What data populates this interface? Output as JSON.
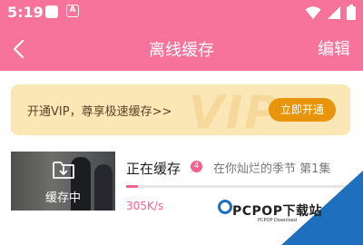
{
  "status_bar": {
    "time": "5:19",
    "icons": [
      "app-square-icon",
      "a-badge-icon",
      "wifi-icon",
      "signal-icon",
      "battery-icon"
    ]
  },
  "header": {
    "back_icon": "chevron-left-icon",
    "title": "离线缓存",
    "edit_label": "编辑"
  },
  "vip_banner": {
    "text": "开通VIP，尊享极速缓存>>",
    "button_label": "立即开通",
    "watermark": "VIP"
  },
  "download_item": {
    "thumbnail_caption": "缓存中",
    "status": "正在缓存",
    "count": "4",
    "title": "在你灿烂的季节 第1集",
    "speed": "305K/s",
    "progress": 0.05
  },
  "watermark": {
    "brand": "PCPOP下载站",
    "sub": "PCPOP Download"
  },
  "colors": {
    "header_bg": "#f7739b",
    "accent": "#f2628d",
    "vip_bg": "#fbe7b6",
    "vip_button": "#e8950c"
  }
}
